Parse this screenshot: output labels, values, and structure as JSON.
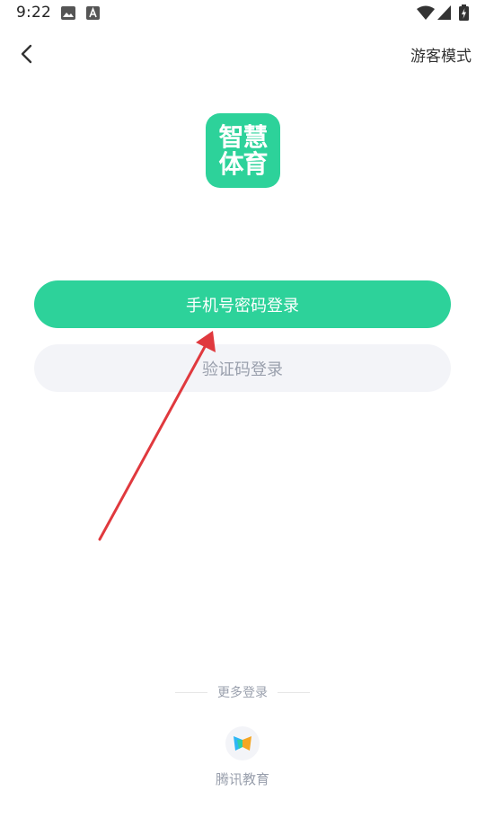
{
  "status_bar": {
    "time": "9:22",
    "icons": [
      "image-icon",
      "a-icon",
      "wifi-icon",
      "signal-icon",
      "battery-charging-icon"
    ]
  },
  "header": {
    "back_icon": "chevron-left-icon",
    "guest_mode": "游客模式"
  },
  "logo": {
    "line1": "智慧",
    "line2": "体育",
    "color": "#2dd29a"
  },
  "login": {
    "password_login": "手机号密码登录",
    "code_login": "验证码登录"
  },
  "more_login": {
    "title": "更多登录",
    "tencent_label": "腾讯教育",
    "tencent_icon": "butterfly-icon"
  },
  "colors": {
    "accent": "#2dd29a",
    "secondary_bg": "#f3f4f8",
    "annotation": "#e0393e"
  }
}
